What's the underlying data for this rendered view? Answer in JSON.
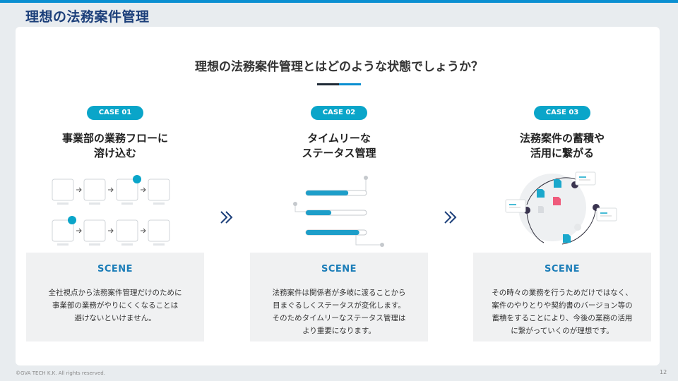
{
  "page_title": "理想の法務案件管理",
  "question": "理想の法務案件管理とはどのような状態でしょうか？",
  "cases": [
    {
      "badge": "CASE 01",
      "heading_line1": "事業部の業務フローに",
      "heading_line2": "溶け込む",
      "scene_title": "SCENE",
      "scene_lines": [
        "全社視点から法務案件管理だけのために",
        "事業部の業務がやりにくくなることは",
        "避けないといけません。"
      ]
    },
    {
      "badge": "CASE 02",
      "heading_line1": "タイムリーな",
      "heading_line2": "ステータス管理",
      "scene_title": "SCENE",
      "scene_lines": [
        "法務案件は関係者が多岐に渡ることから",
        "目まぐるしくステータスが変化します。",
        "そのためタイムリーなステータス管理は",
        "より重要になります。"
      ]
    },
    {
      "badge": "CASE 03",
      "heading_line1": "法務案件の蓄積や",
      "heading_line2": "活用に繋がる",
      "scene_title": "SCENE",
      "scene_lines": [
        "その時々の業務を行うためだけではなく、",
        "案件のやりとりや契約書のバージョン等の",
        "蓄積をすることにより、今後の業務の活用",
        "に繋がっていくのが理想です。"
      ]
    }
  ],
  "progress_bars": [
    0.7,
    0.42,
    0.88
  ],
  "footer": "©GVA TECH K.K. All rights reserved.",
  "page_number": "12",
  "colors": {
    "accent": "#0aa5c9",
    "title": "#1c3f7a",
    "scene_title": "#1b7db8"
  }
}
